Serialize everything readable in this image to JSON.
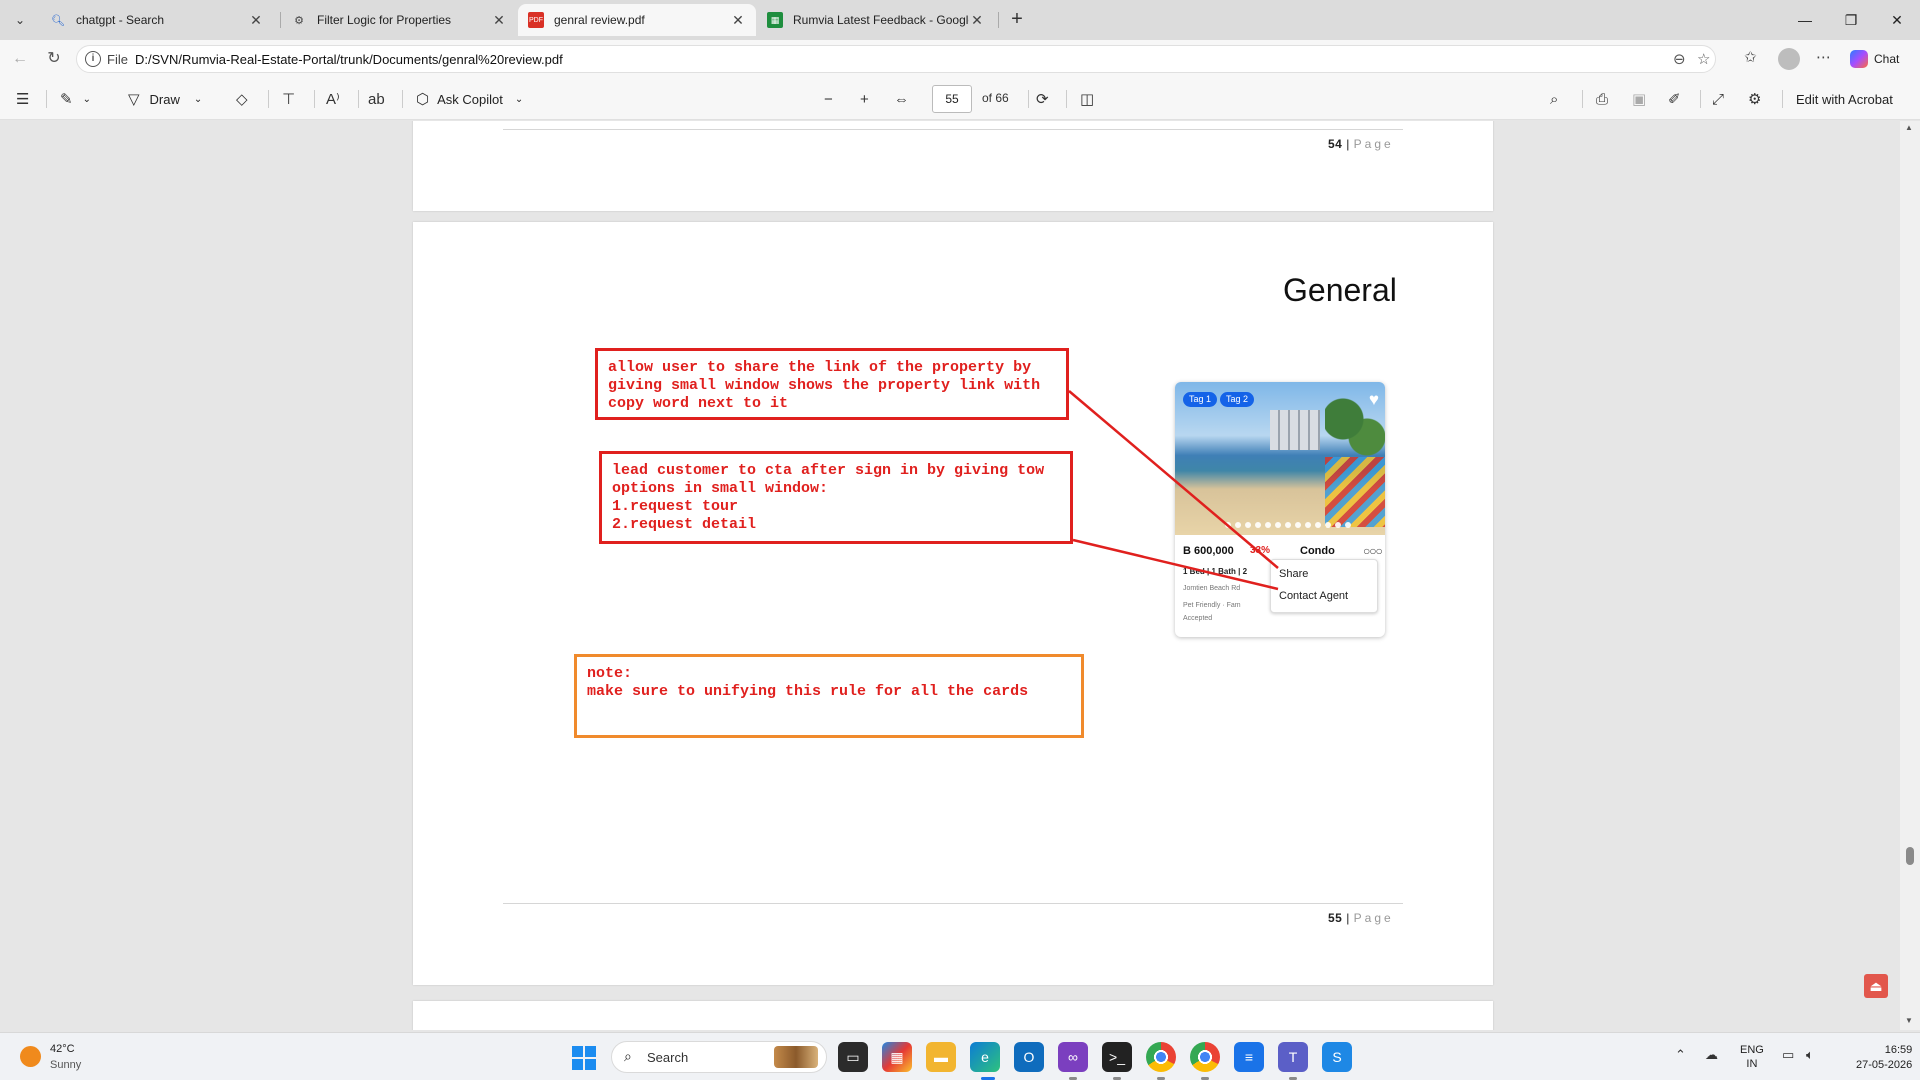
{
  "browser": {
    "tabs": [
      {
        "label": "chatgpt - Search",
        "icon": "search-icon"
      },
      {
        "label": "Filter Logic for Properties",
        "icon": "openai-icon"
      },
      {
        "label": "genral review.pdf",
        "icon": "pdf-icon"
      },
      {
        "label": "Rumvia Latest Feedback - Google",
        "icon": "sheets-icon"
      }
    ],
    "active_tab": 2,
    "address": {
      "scheme": "File",
      "url": "D:/SVN/Rumvia-Real-Estate-Portal/trunk/Documents/genral%20review.pdf"
    },
    "chat_label": "Chat"
  },
  "pdf_toolbar": {
    "draw_label": "Draw",
    "ask_copilot_label": "Ask Copilot",
    "page_current": "55",
    "page_total": "of 66",
    "edit_acrobat_label": "Edit with Acrobat"
  },
  "document": {
    "prev_page": {
      "num": "54",
      "page_word": "Page"
    },
    "page": {
      "heading": "General",
      "annotation_share": "allow user to share the link of the property by\ngiving small window shows the property link with\ncopy word next to it",
      "annotation_cta": "lead customer to cta after sign in by giving tow\noptions in small window:\n1.request tour\n2.request detail",
      "note": "note:\nmake sure to unifying this rule for  all the cards",
      "num": "55",
      "page_word": "Page",
      "annotation_color": "#e0201e",
      "note_border_color": "#f08a2c"
    },
    "card": {
      "tag1": "Tag 1",
      "tag2": "Tag 2",
      "price": "B 600,000",
      "discount": "33%",
      "type": "Condo",
      "specs": "1 Bed | 1 Bath | 2",
      "location": "Jomtien Beach Rd",
      "features": "Pet Friendly  ·  Fam",
      "features2": "Accepted",
      "menu_share": "Share",
      "menu_contact": "Contact Agent"
    }
  },
  "taskbar": {
    "weather_temp": "42°C",
    "weather_cond": "Sunny",
    "search_placeholder": "Search",
    "lang_line1": "ENG",
    "lang_line2": "IN",
    "time": "16:59",
    "date": "27-05-2026"
  }
}
